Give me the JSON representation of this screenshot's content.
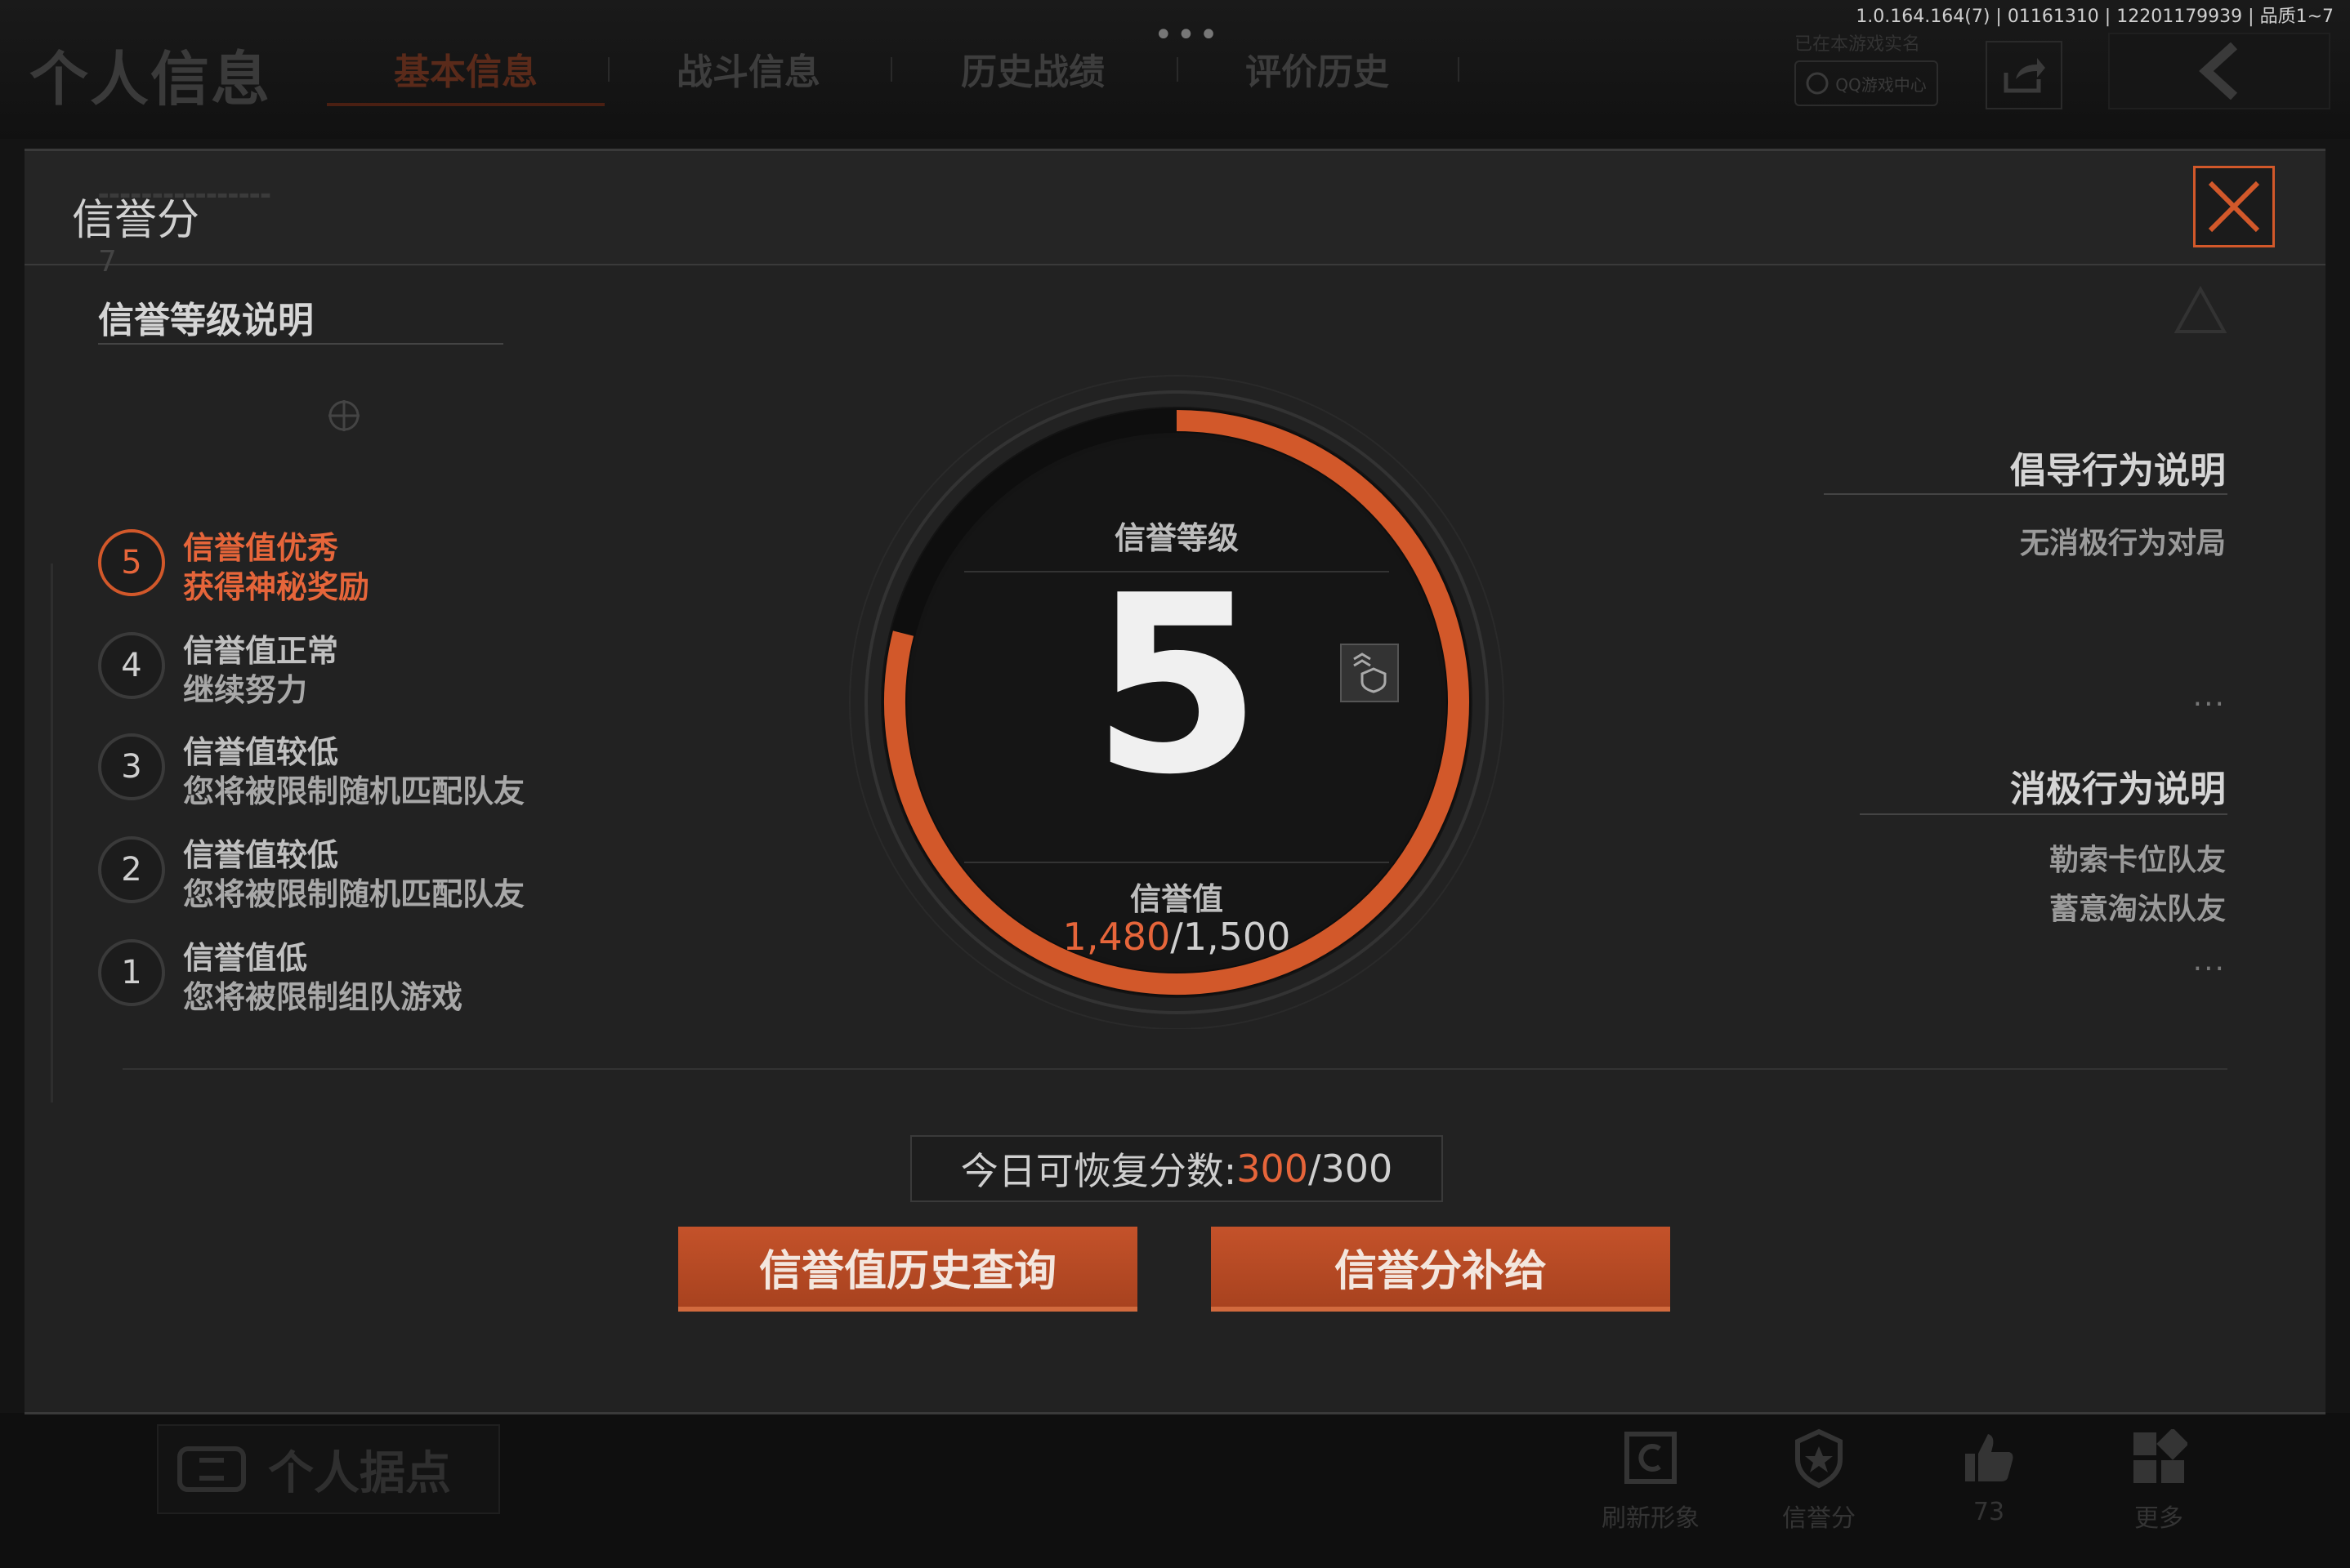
{
  "header": {
    "page_title": "个人信息",
    "tabs": [
      {
        "label": "基本信息"
      },
      {
        "label": "战斗信息"
      },
      {
        "label": "历史战绩"
      },
      {
        "label": "评价历史"
      }
    ],
    "version_info": "1.0.164.164(7) | 01161310 | 12201179939 | 品质1~7",
    "verified_text": "已在本游戏实名",
    "qq_button": "QQ游戏中心"
  },
  "dialog": {
    "title": "信誉分",
    "left": {
      "heading": "信誉等级说明",
      "marker_number": "7",
      "levels": [
        {
          "num": "5",
          "title": "信誉值优秀",
          "desc": "获得神秘奖励"
        },
        {
          "num": "4",
          "title": "信誉值正常",
          "desc": "继续努力"
        },
        {
          "num": "3",
          "title": "信誉值较低",
          "desc": "您将被限制随机匹配队友"
        },
        {
          "num": "2",
          "title": "信誉值较低",
          "desc": "您将被限制随机匹配队友"
        },
        {
          "num": "1",
          "title": "信誉值低",
          "desc": "您将被限制组队游戏"
        }
      ]
    },
    "center": {
      "rank_label": "信誉等级",
      "rank_value": "5",
      "score_label": "信誉值",
      "score_current": "1,480",
      "score_max": "/1,500",
      "score_fraction": 0.9867
    },
    "right": {
      "encouraged_heading": "倡导行为说明",
      "encouraged_items": [
        "无消极行为对局"
      ],
      "negative_heading": "消极行为说明",
      "negative_items": [
        "勒索卡位队友",
        "蓄意淘汰队友"
      ],
      "more": "..."
    },
    "recover": {
      "label": "今日可恢复分数:",
      "current": "300",
      "max": "/300"
    },
    "buttons": {
      "history": "信誉值历史查询",
      "supply": "信誉分补给"
    }
  },
  "bottom": {
    "personal_base": "个人据点",
    "items": [
      {
        "label": "刷新形象",
        "icon": "refresh-icon"
      },
      {
        "label": "信誉分",
        "icon": "credit-badge-icon"
      },
      {
        "label": "73",
        "icon": "thumbs-up-icon"
      },
      {
        "label": "更多",
        "icon": "grid-more-icon"
      }
    ]
  },
  "colors": {
    "accent": "#e6653a",
    "ring": "#d2582a",
    "background": "#222222"
  }
}
